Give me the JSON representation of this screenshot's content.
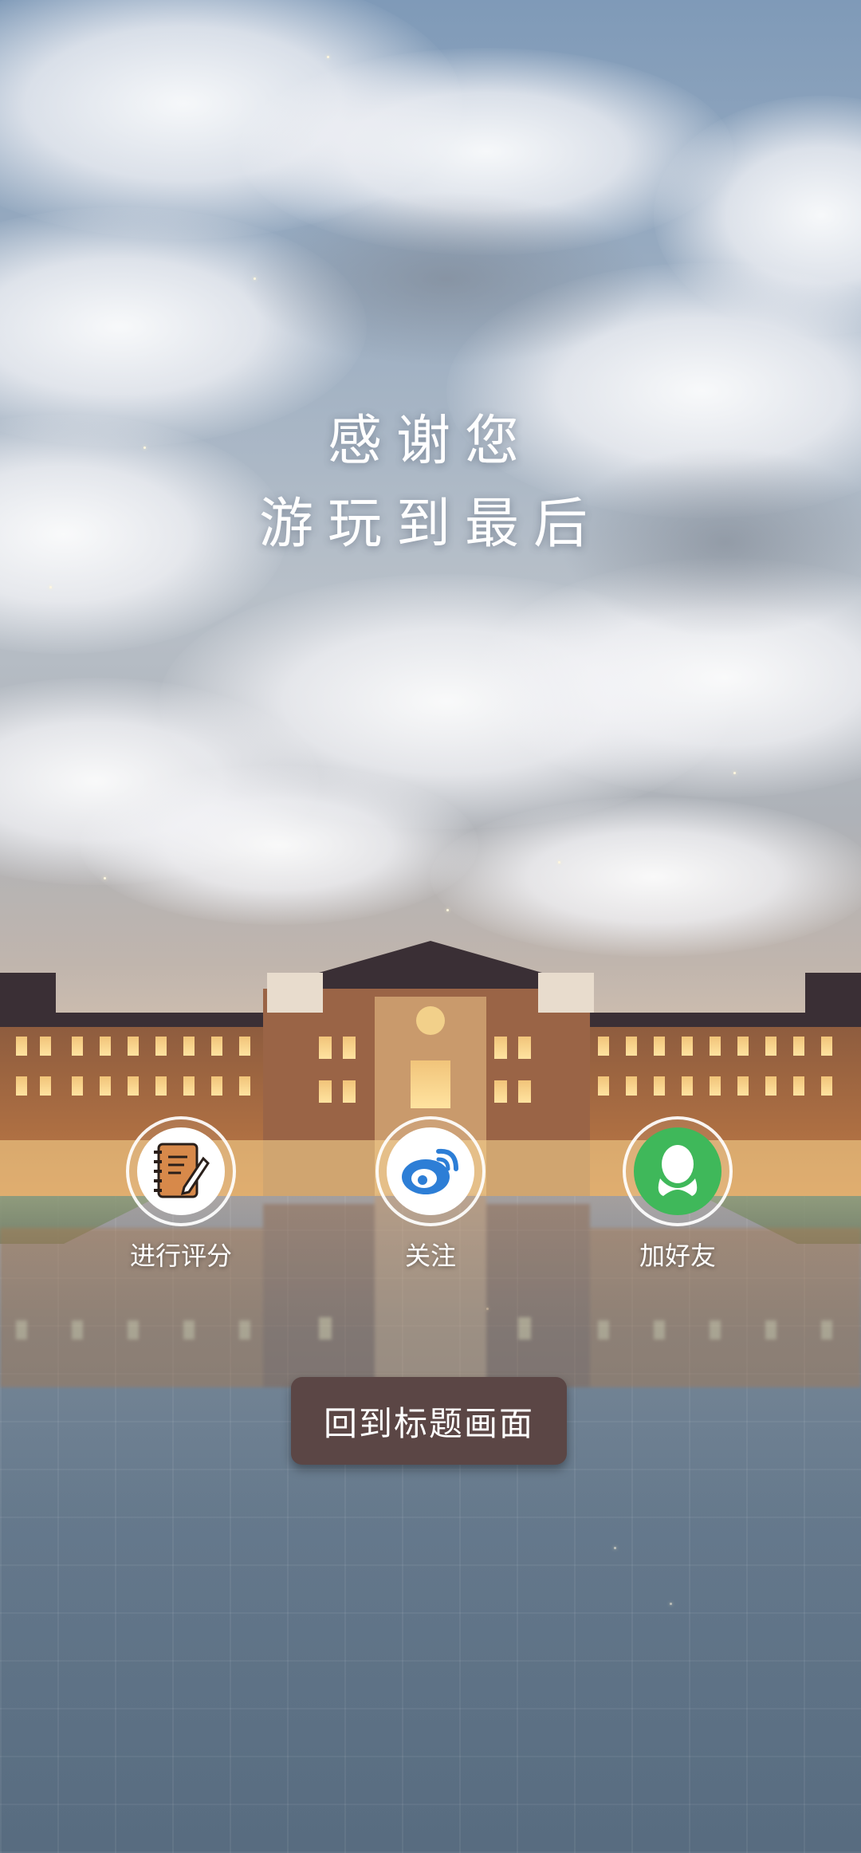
{
  "thanks": {
    "line1": "感谢您",
    "line2": "游玩到最后"
  },
  "actions": [
    {
      "label": "进行评分",
      "icon": "notebook-pencil-icon"
    },
    {
      "label": "关注",
      "icon": "weibo-icon"
    },
    {
      "label": "加好友",
      "icon": "qq-penguin-icon"
    }
  ],
  "return_button": {
    "label": "回到标题画面"
  },
  "colors": {
    "button_bg": "#5b4645",
    "weibo_blue": "#2d7ed6",
    "qq_green": "#3fb85a",
    "notebook_orange": "#d7894a"
  }
}
